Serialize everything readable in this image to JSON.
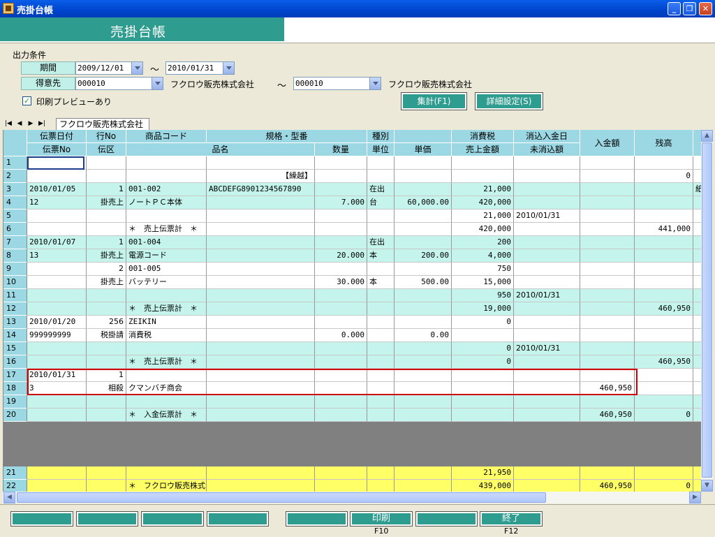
{
  "window": {
    "title": "売掛台帳",
    "min_icon": "minimize-icon",
    "max_icon": "restore-icon",
    "close_icon": "close-icon"
  },
  "banner": {
    "title": "売掛台帳"
  },
  "conditions": {
    "section_label": "出力条件",
    "period_label": "期間",
    "period_from": "2009/12/01",
    "tilde": "〜",
    "period_to": "2010/01/31",
    "customer_label": "得意先",
    "customer_from_code": "000010",
    "customer_from_name": "フクロウ販売株式会社",
    "customer_to_code": "000010",
    "customer_to_name": "フクロウ販売株式会社",
    "preview_checked": true,
    "preview_label": "印刷プレビューあり",
    "aggregate_button": "集計(F1)",
    "detail_button": "詳細設定(S)"
  },
  "tabs": {
    "sheet_label": "フクロウ販売株式会社"
  },
  "grid": {
    "header_row1": [
      "伝票日付",
      "行No",
      "商品コード",
      "規格・型番",
      "",
      "種別",
      "",
      "消費税",
      "消込入金日",
      "入金額",
      "残高"
    ],
    "header_row2": [
      "伝票No",
      "伝区",
      "品名",
      "数量",
      "単位",
      "単価",
      "売上金額",
      "未消込額"
    ],
    "rows": [
      {
        "n": "1",
        "c": [
          "",
          "",
          "",
          "",
          "",
          "",
          "",
          "",
          "",
          "",
          ""
        ]
      },
      {
        "n": "2",
        "c": [
          "",
          "",
          "",
          "【繰越】",
          "",
          "",
          "",
          "",
          "",
          "",
          "0"
        ]
      },
      {
        "n": "3",
        "c": [
          "2010/01/05",
          "1",
          "001-002",
          "ABCDEFG8901234567890",
          "",
          "在出",
          "",
          "21,000",
          "",
          "",
          ""
        ]
      },
      {
        "n": "4",
        "c": [
          "12",
          "掛売上",
          "ノートＰＣ本体",
          "",
          "7.000",
          "台",
          "60,000.00",
          "420,000",
          "",
          "",
          ""
        ]
      },
      {
        "n": "5",
        "c": [
          "",
          "",
          "",
          "",
          "",
          "",
          "",
          "21,000",
          "2010/01/31",
          "",
          ""
        ]
      },
      {
        "n": "6",
        "c": [
          "",
          "",
          "＊　売上伝票計　＊",
          "",
          "",
          "",
          "",
          "420,000",
          "",
          "",
          "441,000"
        ]
      },
      {
        "n": "7",
        "c": [
          "2010/01/07",
          "1",
          "001-004",
          "",
          "",
          "在出",
          "",
          "200",
          "",
          "",
          ""
        ]
      },
      {
        "n": "8",
        "c": [
          "13",
          "掛売上",
          "電源コード",
          "",
          "20.000",
          "本",
          "200.00",
          "4,000",
          "",
          "",
          ""
        ]
      },
      {
        "n": "9",
        "c": [
          "",
          "2",
          "001-005",
          "",
          "",
          "",
          "",
          "750",
          "",
          "",
          ""
        ]
      },
      {
        "n": "10",
        "c": [
          "",
          "掛売上",
          "バッテリー",
          "",
          "30.000",
          "本",
          "500.00",
          "15,000",
          "",
          "",
          ""
        ]
      },
      {
        "n": "11",
        "c": [
          "",
          "",
          "",
          "",
          "",
          "",
          "",
          "950",
          "2010/01/31",
          "",
          ""
        ]
      },
      {
        "n": "12",
        "c": [
          "",
          "",
          "＊　売上伝票計　＊",
          "",
          "",
          "",
          "",
          "19,000",
          "",
          "",
          "460,950"
        ]
      },
      {
        "n": "13",
        "c": [
          "2010/01/20",
          "256",
          "ZEIKIN",
          "",
          "",
          "",
          "",
          "0",
          "",
          "",
          ""
        ]
      },
      {
        "n": "14",
        "c": [
          "999999999",
          "税掛請",
          "消費税",
          "",
          "0.000",
          "",
          "0.00",
          "",
          "",
          "",
          ""
        ]
      },
      {
        "n": "15",
        "c": [
          "",
          "",
          "",
          "",
          "",
          "",
          "",
          "0",
          "2010/01/31",
          "",
          ""
        ]
      },
      {
        "n": "16",
        "c": [
          "",
          "",
          "＊　売上伝票計　＊",
          "",
          "",
          "",
          "",
          "0",
          "",
          "",
          "460,950"
        ]
      },
      {
        "n": "17",
        "c": [
          "2010/01/31",
          "1",
          "",
          "",
          "",
          "",
          "",
          "",
          "",
          "",
          ""
        ]
      },
      {
        "n": "18",
        "c": [
          "3",
          "相殺",
          "クマンバチ商会",
          "",
          "",
          "",
          "",
          "",
          "",
          "460,950",
          ""
        ]
      },
      {
        "n": "19",
        "c": [
          "",
          "",
          "",
          "",
          "",
          "",
          "",
          "",
          "",
          "",
          ""
        ]
      },
      {
        "n": "20",
        "c": [
          "",
          "",
          "＊　入金伝票計　＊",
          "",
          "",
          "",
          "",
          "",
          "",
          "460,950",
          "0"
        ]
      }
    ],
    "total_rows": [
      {
        "n": "21",
        "c": [
          "",
          "",
          "",
          "",
          "",
          "",
          "",
          "21,950",
          "",
          "",
          ""
        ]
      },
      {
        "n": "22",
        "c": [
          "",
          "",
          "＊　フクロウ販売株式会社計　＊",
          "",
          "",
          "",
          "",
          "439,000",
          "",
          "460,950",
          "0"
        ]
      }
    ],
    "overflow_text": "紙",
    "row_colors": {
      "white": "#ffffff",
      "teal": "#c4f4ec",
      "yellow": "#ffff66",
      "header": "#9cd8e4",
      "selection": "#d00000"
    }
  },
  "footer": {
    "buttons": [
      "",
      "",
      "",
      "",
      "",
      "印刷",
      "",
      "終了"
    ],
    "keys": [
      "",
      "",
      "",
      "",
      "",
      "F10",
      "",
      "F12"
    ]
  },
  "colors": {
    "accent": "#2f9c90",
    "titlebar": "#0a5ee8"
  }
}
